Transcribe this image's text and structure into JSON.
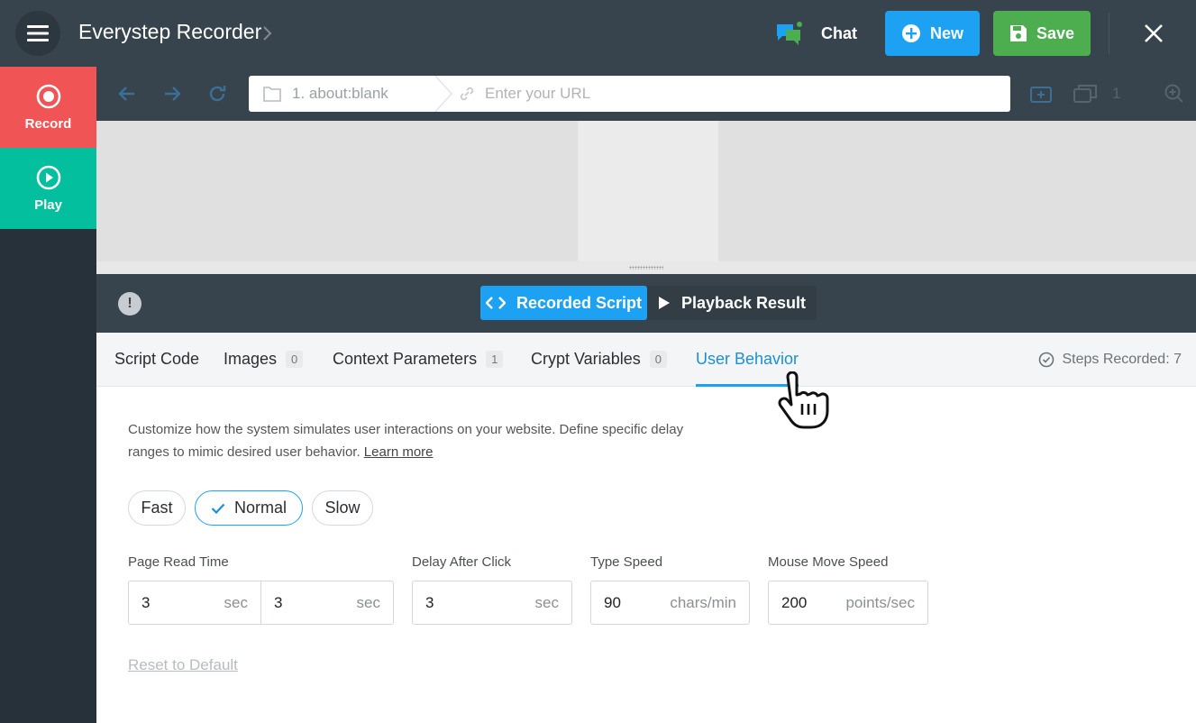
{
  "header": {
    "title": "Everystep Recorder",
    "chat_label": "Chat",
    "new_label": "New",
    "save_label": "Save"
  },
  "sidebar": {
    "record_label": "Record",
    "play_label": "Play"
  },
  "browser": {
    "tab_label": "1. about:blank",
    "url_placeholder": "Enter your URL",
    "tab_count": "1"
  },
  "mode": {
    "recorded_label": "Recorded Script",
    "playback_label": "Playback Result"
  },
  "tabs": [
    {
      "label": "Script Code",
      "badge": ""
    },
    {
      "label": "Images",
      "badge": "0"
    },
    {
      "label": "Context Parameters",
      "badge": "1"
    },
    {
      "label": "Crypt Variables",
      "badge": "0"
    },
    {
      "label": "User Behavior",
      "badge": ""
    }
  ],
  "steps_recorded": "Steps Recorded: 7",
  "content": {
    "description": "Customize how the system simulates user interactions on your website. Define specific delay ranges to mimic desired user behavior.",
    "learn_more": "Learn more",
    "speeds": [
      "Fast",
      "Normal",
      "Slow"
    ],
    "selected_speed": "Normal",
    "fields": {
      "page_read_time": {
        "label": "Page Read Time",
        "min": "3",
        "max": "3",
        "unit": "sec"
      },
      "delay_after_click": {
        "label": "Delay After Click",
        "value": "3",
        "unit": "sec"
      },
      "type_speed": {
        "label": "Type Speed",
        "value": "90",
        "unit": "chars/min"
      },
      "mouse_move_speed": {
        "label": "Mouse Move Speed",
        "value": "200",
        "unit": "points/sec"
      }
    },
    "reset_label": "Reset to Default"
  },
  "colors": {
    "topbar": "#37434d",
    "record": "#f05454",
    "play": "#03bf9d",
    "accent_blue": "#1da1f2",
    "save_green": "#4cae4f"
  },
  "icons": {
    "menu": "hamburger-icon",
    "chat": "chat-bubbles-icon",
    "new": "plus-circle-icon",
    "save": "floppy-disk-icon",
    "close": "close-icon",
    "record": "record-icon",
    "play": "play-circle-icon"
  }
}
